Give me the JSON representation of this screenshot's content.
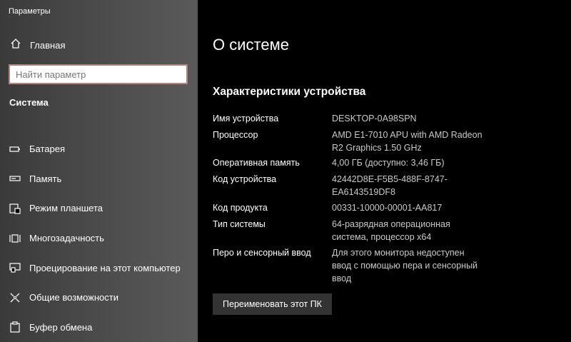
{
  "window": {
    "title": "Параметры"
  },
  "sidebar": {
    "home_label": "Главная",
    "search": {
      "placeholder": "Найти параметр"
    },
    "section": "Система",
    "items": [
      {
        "label": "Батарея",
        "icon": "battery-icon"
      },
      {
        "label": "Память",
        "icon": "storage-icon"
      },
      {
        "label": "Режим планшета",
        "icon": "tablet-mode-icon"
      },
      {
        "label": "Многозадачность",
        "icon": "multitasking-icon"
      },
      {
        "label": "Проецирование на этот компьютер",
        "icon": "projecting-icon"
      },
      {
        "label": "Общие возможности",
        "icon": "shared-experiences-icon"
      },
      {
        "label": "Буфер обмена",
        "icon": "clipboard-icon"
      }
    ]
  },
  "main": {
    "title": "О системе",
    "subtitle": "Характеристики устройства",
    "specs": [
      {
        "key": "Имя устройства",
        "value": "DESKTOP-0A98SPN"
      },
      {
        "key": "Процессор",
        "value": "AMD E1-7010 APU with AMD Radeon\nR2 Graphics        1.50 GHz"
      },
      {
        "key": "Оперативная память",
        "value": "4,00 ГБ (доступно: 3,46 ГБ)"
      },
      {
        "key": "Код устройства",
        "value": "42442D8E-F5B5-488F-8747-\nEA6143519DF8"
      },
      {
        "key": "Код продукта",
        "value": "00331-10000-00001-AA817"
      },
      {
        "key": "Тип системы",
        "value": "64-разрядная операционная\nсистема, процессор x64"
      },
      {
        "key": "Перо и сенсорный ввод",
        "value": "Для этого монитора недоступен\nввод с помощью пера и сенсорный\nввод"
      }
    ],
    "rename_button": "Переименовать этот ПК"
  },
  "colors": {
    "sidebar": "#4a4a4a",
    "main_bg": "#000000",
    "search_border": "#b0877a",
    "button_bg": "#333333"
  }
}
